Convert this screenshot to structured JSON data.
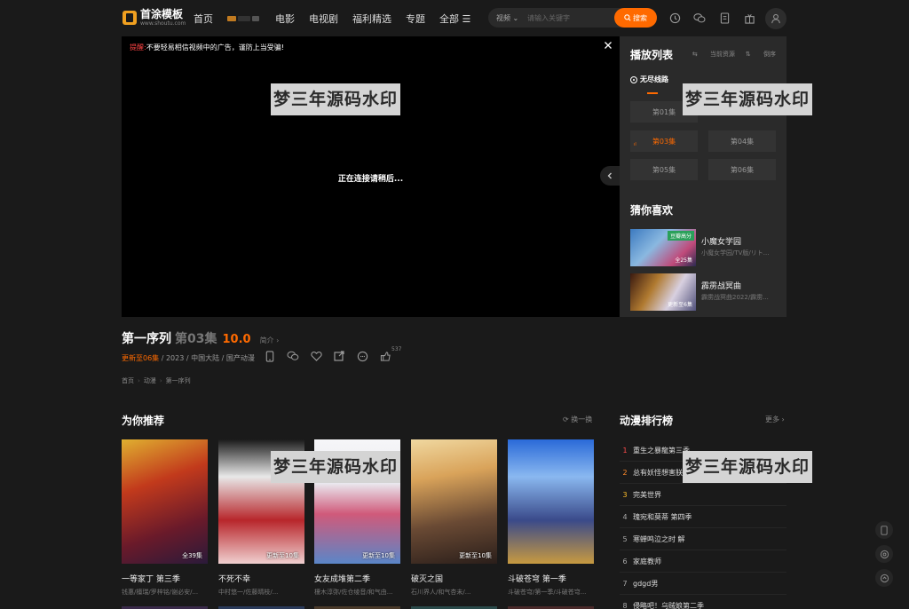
{
  "header": {
    "logo_title": "首涂模板",
    "logo_sub": "www.shoutu.com",
    "nav": [
      "首页",
      "电影",
      "电视剧",
      "福利精选",
      "专题",
      "全部 ☰"
    ],
    "search": {
      "type": "视频",
      "placeholder": "请输入关键字",
      "button": "搜索"
    },
    "icons": [
      "clock-icon",
      "wechat-icon",
      "bookmark-icon",
      "gift-icon",
      "user-icon"
    ]
  },
  "player": {
    "notice_label": "提醒:",
    "notice_text": "不要轻易相信视频中的广告，谨防上当受骗!",
    "loading": "正在连接请稍后..."
  },
  "watermark": "梦三年源码水印",
  "playlist": {
    "title": "播放列表",
    "tool_current": "当前资源",
    "tool_sort": "倒序",
    "line": "无尽线路",
    "episodes": [
      "第01集",
      "第03集",
      "第04集",
      "第05集",
      "第06集"
    ],
    "playing_mark": "ıl"
  },
  "guess": {
    "title": "猜你喜欢",
    "items": [
      {
        "name": "小魔女学园",
        "desc": "小魔女学园/TV版/リト...",
        "badge": "豆瓣高分",
        "episodes": "全25集"
      },
      {
        "name": "霹雳战冥曲",
        "desc": "霹雳战冥曲2022/霹雳...",
        "badge": "",
        "episodes": "更新至6集"
      }
    ]
  },
  "info": {
    "title": "第一序列",
    "episode": "第03集",
    "score": "10.0",
    "brief": "简介 ›",
    "update": "更新至06集",
    "year": "2023",
    "region": "中国大陆",
    "genre": "国产动漫",
    "like_count": "537",
    "crumbs": [
      "首页",
      "动漫",
      "第一序列"
    ]
  },
  "recommend": {
    "title": "为你推荐",
    "refresh": "换一换",
    "cards": [
      {
        "name": "一等家丁 第三季",
        "desc": "钱惠/檀瑞/罗梓铭/谢必安/...",
        "episodes": "全39集",
        "c1": "#c23a1c",
        "c2": "#3b1a2a"
      },
      {
        "name": "不死不幸",
        "desc": "中村悠一/佐藤晴枝/...",
        "episodes": "更新至10集",
        "c1": "#e8e8e8",
        "c2": "#b8262b"
      },
      {
        "name": "女友成堆第二季",
        "desc": "榎木淳弥/佐仓绫音/和气由...",
        "episodes": "更新至10集",
        "c1": "#f2f2f5",
        "c2": "#5a86c8"
      },
      {
        "name": "破灭之国",
        "desc": "石川界人/和气杏未/...",
        "episodes": "更新至10集",
        "c1": "#d9a35a",
        "c2": "#3a2a24"
      },
      {
        "name": "斗破苍穹 第一季",
        "desc": "斗破苍穹/第一季/斗破苍穹...",
        "episodes": "",
        "c1": "#3a6fc8",
        "c2": "#1a2a4a"
      }
    ]
  },
  "ranking": {
    "title": "动漫排行榜",
    "more": "更多 ›",
    "items": [
      "重生之暴龍第三季",
      "总有妖怪想害朕",
      "完美世界",
      "瑰宛和莫蒂 第四季",
      "寒蝉鸣泣之时 解",
      "家庭教师",
      "gdgd男",
      "侵略吧！乌贼娘第二季"
    ]
  }
}
